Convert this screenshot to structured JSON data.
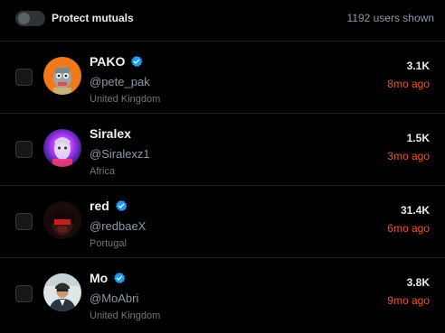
{
  "header": {
    "toggle_label": "Protect mutuals",
    "users_shown": "1192 users shown"
  },
  "users": [
    {
      "name": "PAKO",
      "verified": true,
      "handle": "@pete_pak",
      "location": "United Kingdom",
      "followers": "3.1K",
      "last_active": "8mo ago"
    },
    {
      "name": "Siralex",
      "verified": false,
      "handle": "@Siralexz1",
      "location": "Africa",
      "followers": "1.5K",
      "last_active": "3mo ago"
    },
    {
      "name": "red",
      "verified": true,
      "handle": "@redbaeX",
      "location": "Portugal",
      "followers": "31.4K",
      "last_active": "6mo ago"
    },
    {
      "name": "Mo",
      "verified": true,
      "handle": "@MoAbri",
      "location": "United Kingdom",
      "followers": "3.8K",
      "last_active": "9mo ago"
    }
  ],
  "colors": {
    "background": "#000000",
    "verified_badge": "#1d9bf0",
    "last_active": "#f4511e"
  },
  "icons": {
    "verified": "verified-badge-icon"
  }
}
